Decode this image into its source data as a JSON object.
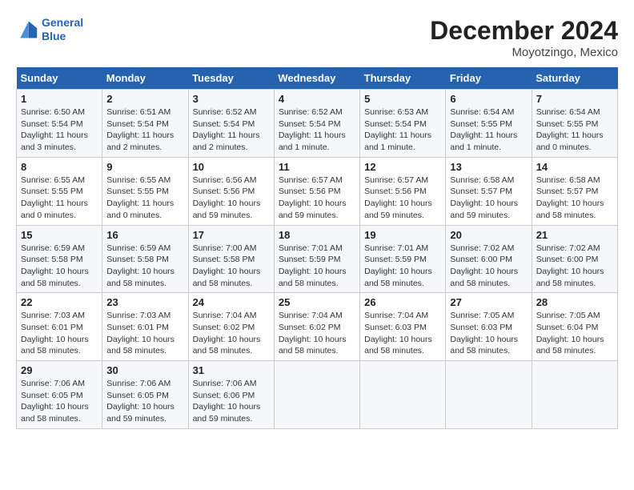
{
  "header": {
    "logo_line1": "General",
    "logo_line2": "Blue",
    "month": "December 2024",
    "location": "Moyotzingo, Mexico"
  },
  "weekdays": [
    "Sunday",
    "Monday",
    "Tuesday",
    "Wednesday",
    "Thursday",
    "Friday",
    "Saturday"
  ],
  "weeks": [
    [
      {
        "day": "1",
        "sunrise": "6:50 AM",
        "sunset": "5:54 PM",
        "daylight": "11 hours and 3 minutes."
      },
      {
        "day": "2",
        "sunrise": "6:51 AM",
        "sunset": "5:54 PM",
        "daylight": "11 hours and 2 minutes."
      },
      {
        "day": "3",
        "sunrise": "6:52 AM",
        "sunset": "5:54 PM",
        "daylight": "11 hours and 2 minutes."
      },
      {
        "day": "4",
        "sunrise": "6:52 AM",
        "sunset": "5:54 PM",
        "daylight": "11 hours and 1 minute."
      },
      {
        "day": "5",
        "sunrise": "6:53 AM",
        "sunset": "5:54 PM",
        "daylight": "11 hours and 1 minute."
      },
      {
        "day": "6",
        "sunrise": "6:54 AM",
        "sunset": "5:55 PM",
        "daylight": "11 hours and 1 minute."
      },
      {
        "day": "7",
        "sunrise": "6:54 AM",
        "sunset": "5:55 PM",
        "daylight": "11 hours and 0 minutes."
      }
    ],
    [
      {
        "day": "8",
        "sunrise": "6:55 AM",
        "sunset": "5:55 PM",
        "daylight": "11 hours and 0 minutes."
      },
      {
        "day": "9",
        "sunrise": "6:55 AM",
        "sunset": "5:55 PM",
        "daylight": "11 hours and 0 minutes."
      },
      {
        "day": "10",
        "sunrise": "6:56 AM",
        "sunset": "5:56 PM",
        "daylight": "10 hours and 59 minutes."
      },
      {
        "day": "11",
        "sunrise": "6:57 AM",
        "sunset": "5:56 PM",
        "daylight": "10 hours and 59 minutes."
      },
      {
        "day": "12",
        "sunrise": "6:57 AM",
        "sunset": "5:56 PM",
        "daylight": "10 hours and 59 minutes."
      },
      {
        "day": "13",
        "sunrise": "6:58 AM",
        "sunset": "5:57 PM",
        "daylight": "10 hours and 59 minutes."
      },
      {
        "day": "14",
        "sunrise": "6:58 AM",
        "sunset": "5:57 PM",
        "daylight": "10 hours and 58 minutes."
      }
    ],
    [
      {
        "day": "15",
        "sunrise": "6:59 AM",
        "sunset": "5:58 PM",
        "daylight": "10 hours and 58 minutes."
      },
      {
        "day": "16",
        "sunrise": "6:59 AM",
        "sunset": "5:58 PM",
        "daylight": "10 hours and 58 minutes."
      },
      {
        "day": "17",
        "sunrise": "7:00 AM",
        "sunset": "5:58 PM",
        "daylight": "10 hours and 58 minutes."
      },
      {
        "day": "18",
        "sunrise": "7:01 AM",
        "sunset": "5:59 PM",
        "daylight": "10 hours and 58 minutes."
      },
      {
        "day": "19",
        "sunrise": "7:01 AM",
        "sunset": "5:59 PM",
        "daylight": "10 hours and 58 minutes."
      },
      {
        "day": "20",
        "sunrise": "7:02 AM",
        "sunset": "6:00 PM",
        "daylight": "10 hours and 58 minutes."
      },
      {
        "day": "21",
        "sunrise": "7:02 AM",
        "sunset": "6:00 PM",
        "daylight": "10 hours and 58 minutes."
      }
    ],
    [
      {
        "day": "22",
        "sunrise": "7:03 AM",
        "sunset": "6:01 PM",
        "daylight": "10 hours and 58 minutes."
      },
      {
        "day": "23",
        "sunrise": "7:03 AM",
        "sunset": "6:01 PM",
        "daylight": "10 hours and 58 minutes."
      },
      {
        "day": "24",
        "sunrise": "7:04 AM",
        "sunset": "6:02 PM",
        "daylight": "10 hours and 58 minutes."
      },
      {
        "day": "25",
        "sunrise": "7:04 AM",
        "sunset": "6:02 PM",
        "daylight": "10 hours and 58 minutes."
      },
      {
        "day": "26",
        "sunrise": "7:04 AM",
        "sunset": "6:03 PM",
        "daylight": "10 hours and 58 minutes."
      },
      {
        "day": "27",
        "sunrise": "7:05 AM",
        "sunset": "6:03 PM",
        "daylight": "10 hours and 58 minutes."
      },
      {
        "day": "28",
        "sunrise": "7:05 AM",
        "sunset": "6:04 PM",
        "daylight": "10 hours and 58 minutes."
      }
    ],
    [
      {
        "day": "29",
        "sunrise": "7:06 AM",
        "sunset": "6:05 PM",
        "daylight": "10 hours and 58 minutes."
      },
      {
        "day": "30",
        "sunrise": "7:06 AM",
        "sunset": "6:05 PM",
        "daylight": "10 hours and 59 minutes."
      },
      {
        "day": "31",
        "sunrise": "7:06 AM",
        "sunset": "6:06 PM",
        "daylight": "10 hours and 59 minutes."
      },
      null,
      null,
      null,
      null
    ]
  ],
  "labels": {
    "sunrise": "Sunrise:",
    "sunset": "Sunset:",
    "daylight": "Daylight:"
  }
}
